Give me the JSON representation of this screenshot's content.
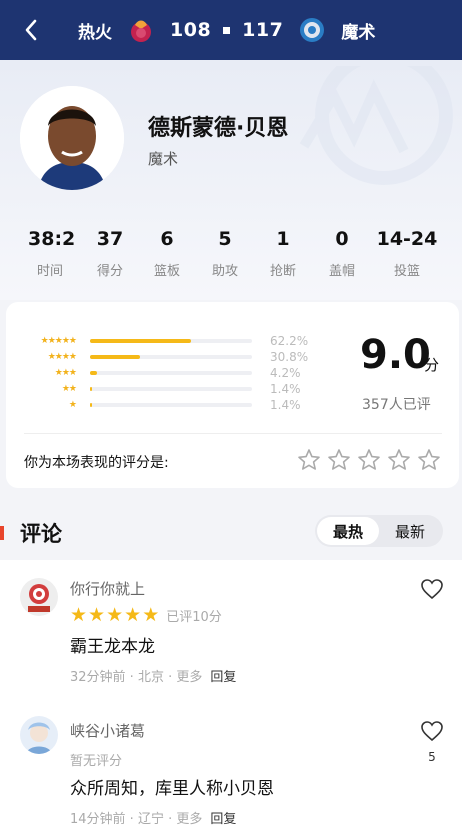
{
  "header": {
    "home_team": "热火",
    "home_score": "108",
    "away_score": "117",
    "away_team": "魔术"
  },
  "player": {
    "name": "德斯蒙德·贝恩",
    "team": "魔术"
  },
  "stats": [
    {
      "value": "38:2",
      "label": "时间"
    },
    {
      "value": "37",
      "label": "得分"
    },
    {
      "value": "6",
      "label": "篮板"
    },
    {
      "value": "5",
      "label": "助攻"
    },
    {
      "value": "1",
      "label": "抢断"
    },
    {
      "value": "0",
      "label": "盖帽"
    },
    {
      "value": "14-24",
      "label": "投篮"
    }
  ],
  "rating": {
    "distribution": [
      {
        "stars": 5,
        "percent": 62.2,
        "label": "62.2%"
      },
      {
        "stars": 4,
        "percent": 30.8,
        "label": "30.8%"
      },
      {
        "stars": 3,
        "percent": 4.2,
        "label": "4.2%"
      },
      {
        "stars": 2,
        "percent": 1.4,
        "label": "1.4%"
      },
      {
        "stars": 1,
        "percent": 1.4,
        "label": "1.4%"
      }
    ],
    "score": "9.0",
    "unit": "分",
    "count_text": "357人已评",
    "my_rating_label": "你为本场表现的评分是:"
  },
  "comments_section": {
    "title": "评论",
    "sort_hot": "最热",
    "sort_new": "最新"
  },
  "comments": [
    {
      "user": "你行你就上",
      "stars": 5,
      "rated_text": "已评10分",
      "body": "霸王龙本龙",
      "time": "32分钟前",
      "location": "北京",
      "more": "更多",
      "reply": "回复",
      "likes": ""
    },
    {
      "user": "峡谷小诸葛",
      "rated_text": "暂无评分",
      "body": "众所周知，库里人称小贝恩",
      "time": "14分钟前",
      "location": "辽宁",
      "more": "更多",
      "reply": "回复",
      "likes": "5"
    }
  ],
  "colors": {
    "header_bg": "#1e3471",
    "star_gold": "#f5b918",
    "accent_red": "#e8452c"
  }
}
